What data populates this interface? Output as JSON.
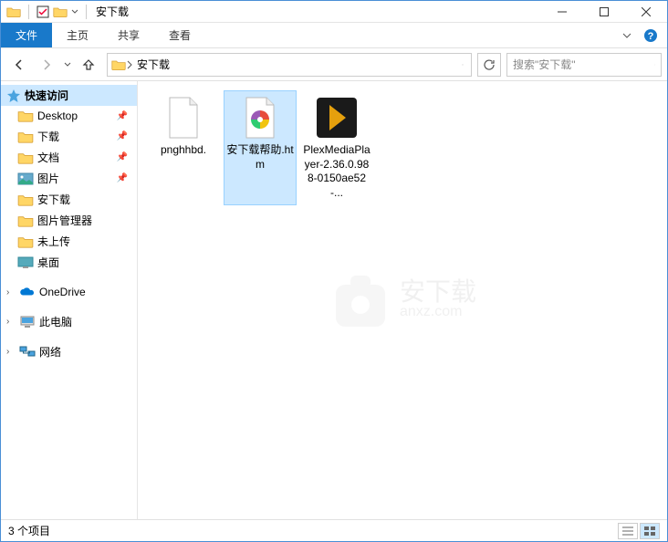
{
  "window": {
    "title": "安下载"
  },
  "ribbon": {
    "file": "文件",
    "tabs": [
      "主页",
      "共享",
      "查看"
    ]
  },
  "address": {
    "crumb": "安下载"
  },
  "search": {
    "placeholder": "搜索\"安下载\""
  },
  "sidebar": {
    "quick_access": "快速访问",
    "pinned": [
      {
        "label": "Desktop",
        "icon": "desktop"
      },
      {
        "label": "下载",
        "icon": "downloads"
      },
      {
        "label": "文档",
        "icon": "documents"
      },
      {
        "label": "图片",
        "icon": "pictures"
      }
    ],
    "folders": [
      {
        "label": "安下载"
      },
      {
        "label": "图片管理器"
      },
      {
        "label": "未上传"
      },
      {
        "label": "桌面"
      }
    ],
    "onedrive": "OneDrive",
    "this_pc": "此电脑",
    "network": "网络"
  },
  "files": [
    {
      "name": "pnghhbd.",
      "type": "blank",
      "selected": false
    },
    {
      "name": "安下载帮助.htm",
      "type": "htm",
      "selected": true
    },
    {
      "name": "PlexMediaPlayer-2.36.0.988-0150ae52-...",
      "type": "plex",
      "selected": false
    }
  ],
  "status": {
    "count": "3 个项目"
  },
  "watermark": {
    "text": "安下载",
    "sub": "anxz.com"
  }
}
